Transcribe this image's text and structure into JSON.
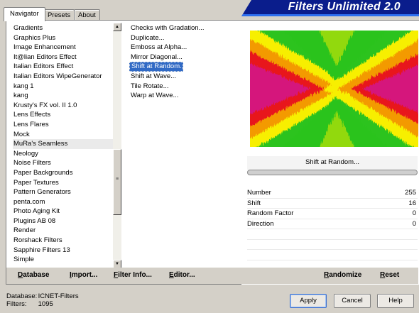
{
  "window": {
    "title": "Filters Unlimited 2.0"
  },
  "tabs": [
    {
      "label": "Navigator",
      "active": true
    },
    {
      "label": "Presets",
      "active": false
    },
    {
      "label": "About",
      "active": false
    }
  ],
  "categories": {
    "items": [
      "Gradients",
      "Graphics Plus",
      "Image Enhancement",
      "It@lian Editors Effect",
      "Italian Editors Effect",
      "Italian Editors WipeGenerator",
      "kang 1",
      "kang",
      "Krusty's FX vol. II 1.0",
      "Lens Effects",
      "Lens Flares",
      "Mock",
      "MuRa's Seamless",
      "Neology",
      "Noise Filters",
      "Paper Backgrounds",
      "Paper Textures",
      "Pattern Generators",
      "penta.com",
      "Photo Aging Kit",
      "Plugins AB 08",
      "Render",
      "Rorshack Filters",
      "Sapphire Filters 13",
      "Simple"
    ],
    "selected": "MuRa's Seamless"
  },
  "filters": {
    "items": [
      "Checks with Gradation...",
      "Duplicate...",
      "Emboss at Alpha...",
      "Mirror Diagonal...",
      "Shift at Random...",
      "Shift at Wave...",
      "Tile Rotate...",
      "Warp at Wave..."
    ],
    "selected": "Shift at Random..."
  },
  "preview": {
    "filter_name": "Shift at Random...",
    "colors": {
      "green": "#2cc31e",
      "yellow": "#f7ef00",
      "orange": "#f39a00",
      "red": "#e8141c",
      "magenta": "#d5127c"
    }
  },
  "params": [
    {
      "name": "Number",
      "value": "255"
    },
    {
      "name": "Shift",
      "value": "16"
    },
    {
      "name": "Random Factor",
      "value": "0"
    },
    {
      "name": "Direction",
      "value": "0"
    }
  ],
  "toolbar": {
    "database": "Database",
    "import": "Import...",
    "filter_info": "Filter Info...",
    "editor": "Editor...",
    "randomize": "Randomize",
    "reset": "Reset"
  },
  "status": {
    "database_label": "Database:",
    "database_value": "ICNET-Filters",
    "filters_label": "Filters:",
    "filters_value": "1095"
  },
  "buttons": {
    "apply": "Apply",
    "cancel": "Cancel",
    "help": "Help"
  }
}
